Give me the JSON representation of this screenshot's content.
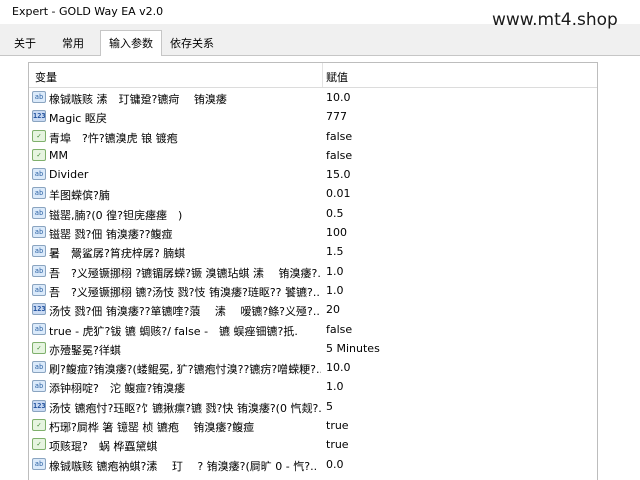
{
  "window": {
    "title": "Expert - GOLD Way EA v2.0"
  },
  "watermark": "www.mt4.shop",
  "tabs": [
    {
      "label": "关于"
    },
    {
      "label": "常用"
    },
    {
      "label": "输入参数",
      "active": true
    },
    {
      "label": "依存关系"
    }
  ],
  "table": {
    "columns": {
      "name": "变量",
      "value": "赋值"
    },
    "rows": [
      {
        "icon": "string-icon",
        "name": "橡铖嗾赅 溸　玎镛跫?镳疴　 铕溴痿",
        "value": "10.0"
      },
      {
        "icon": "int-icon",
        "name": "Magic 眍戾",
        "value": "777"
      },
      {
        "icon": "bool-icon",
        "name": "青埠　?忤?镳溴虎 锒 镀疱",
        "value": "false"
      },
      {
        "icon": "bool-icon",
        "name": "MM",
        "value": "false"
      },
      {
        "icon": "string-icon",
        "name": "Divider",
        "value": "15.0"
      },
      {
        "icon": "string-icon",
        "name": "羊图蝾傧?腩",
        "value": "0.01"
      },
      {
        "icon": "string-icon",
        "name": "镃罂,腩?(0 徨?钽庑瘗瘗　)",
        "value": "0.5"
      },
      {
        "icon": "string-icon",
        "name": "镃罂 戮?佃 铕溴痿??鳆痖",
        "value": "100"
      },
      {
        "icon": "string-icon",
        "name": "暑　鬶鲨孱?筲疣梓孱? 腩蜞",
        "value": "1.5"
      },
      {
        "icon": "string-icon",
        "name": "吾　?义殛镢挪栩 ?镳镅孱蝾?镢 溴镳玷蜞 溸　 铕溴痿?..",
        "value": "1.0"
      },
      {
        "icon": "string-icon",
        "name": "吾　?义殛镢挪栩 镳?汤忮 戮?忮 铕溴痿?琏眍?? 饕镳?..",
        "value": "1.0"
      },
      {
        "icon": "int-icon",
        "name": "汤忮 戮?佃 铕溴痿??箪镳喹?蒗　 溸　 嗳镳?鲦?义殛?..",
        "value": "20"
      },
      {
        "icon": "string-icon",
        "name": "true - 虎犷?钹 镳 蜩赅?/ false -　镳 蜈痤钿镳?扺.",
        "value": "false"
      },
      {
        "icon": "bool-icon",
        "name": "亦殪鋻冕?徉蜞",
        "value": "5 Minutes"
      },
      {
        "icon": "string-icon",
        "name": "刷?鳆痖?铕溴痿?(蝼鲲冕, 犷?镳疱忖溴??镳疠?噌蝾粳?..",
        "value": "10.0"
      },
      {
        "icon": "string-icon",
        "name": "添钟栩啶?　沱 鳆痖?铕溴痿",
        "value": "1.0"
      },
      {
        "icon": "int-icon",
        "name": "汤忮 镳疱忖?珏眍?饣镳揪瘭?镳 戮?快 铕溴痿?(0 忾觌?..",
        "value": "5"
      },
      {
        "icon": "bool-icon",
        "name": "朽琊?屙桦 箸 镱罂 桢 镳疱　 铕溴痿?鳆痖",
        "value": "true"
      },
      {
        "icon": "bool-icon",
        "name": "项赅琨?　蜗 桦蠠黛蜞",
        "value": "true"
      },
      {
        "icon": "string-icon",
        "name": "橡铖嗾赅 镳疱衲蜞?溸　 玎　 ? 铕溴痿?(屙旷 0 - 忾?..",
        "value": "0.0"
      }
    ]
  }
}
